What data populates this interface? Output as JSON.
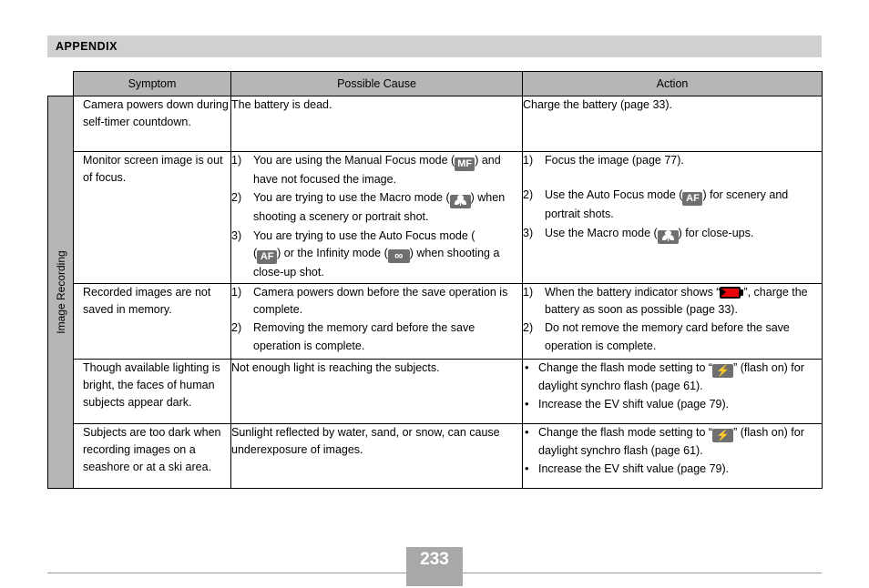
{
  "header": {
    "title": "APPENDIX"
  },
  "sidebar": {
    "label": "Image Recording"
  },
  "table": {
    "columns": [
      "Symptom",
      "Possible Cause",
      "Action"
    ],
    "rows": [
      {
        "symptom": "Camera powers down during self-timer countdown.",
        "cause_lines": [
          "The battery is dead."
        ],
        "action_lines": [
          "Charge the battery (page 33)."
        ]
      },
      {
        "symptom": "Monitor screen image is out of focus.",
        "cause_items": [
          {
            "marker": "1)",
            "pre": "You are using the Manual Focus mode (",
            "icon": "manual-focus-icon",
            "icon_text": "MF",
            "post": ") and have not focused the image."
          },
          {
            "marker": "2)",
            "pre": "You are trying to use the Macro mode (",
            "icon": "macro-icon",
            "icon_text": "",
            "post": ") when shooting a scenery or portrait shot."
          },
          {
            "marker": "3)",
            "pre": "You are trying to use the Auto Focus mode (",
            "icon": "auto-focus-icon",
            "icon_text": "AF",
            "mid": ") or the Infinity mode (",
            "icon2": "infinity-icon",
            "icon2_text": "∞",
            "post": ") when shooting a close-up shot."
          }
        ],
        "action_items": [
          {
            "marker": "1)",
            "pre": "Focus the image (page 77).",
            "icon": "",
            "post": ""
          },
          {
            "marker": "2)",
            "pre": "Use the Auto Focus mode (",
            "icon": "auto-focus-icon",
            "icon_text": "AF",
            "post": ") for scenery and portrait shots."
          },
          {
            "marker": "3)",
            "pre": "Use the Macro mode (",
            "icon": "macro-icon",
            "icon_text": "",
            "post": ") for close-ups."
          }
        ]
      },
      {
        "symptom": "Recorded images are not saved in memory.",
        "cause_items": [
          {
            "marker": "1)",
            "text": "Camera powers down before the save operation is complete."
          },
          {
            "marker": "2)",
            "text": "Removing the memory card before the save operation is complete."
          }
        ],
        "action_items": [
          {
            "marker": "1)",
            "pre": "When the battery indicator shows “",
            "icon": "battery-empty-icon",
            "post": "”, charge the battery as soon as possible (page 33)."
          },
          {
            "marker": "2)",
            "text": "Do not remove the memory card before the save operation is complete."
          }
        ]
      },
      {
        "symptom": "Though available lighting is bright, the faces of human subjects appear dark.",
        "cause_lines": [
          "Not enough light is reaching the subjects."
        ],
        "action_bullets": [
          {
            "marker": "•",
            "pre": "Change the flash mode setting to “",
            "icon": "flash-on-icon",
            "post": "” (flash on) for daylight synchro flash (page 61)."
          },
          {
            "marker": "•",
            "text": "Increase the EV shift value (page 79)."
          }
        ]
      },
      {
        "symptom": "Subjects are too dark when recording images on a seashore or at a ski area.",
        "cause_lines": [
          "Sunlight reflected by water, sand, or snow, can cause underexposure of images."
        ],
        "action_bullets": [
          {
            "marker": "•",
            "pre": "Change the flash mode setting to “",
            "icon": "flash-on-icon",
            "post": "” (flash on) for daylight synchro flash (page 61)."
          },
          {
            "marker": "•",
            "text": "Increase the EV shift value (page 79)."
          }
        ]
      }
    ]
  },
  "footer": {
    "page_number": "233"
  },
  "colors": {
    "header_band": "#d0d0d0",
    "table_header": "#b6b6b6",
    "sidebar": "#b6b6b6",
    "icon_box": "#6f6f6f",
    "battery_fill": "#e8000b",
    "page_block": "#a8a8a8"
  }
}
